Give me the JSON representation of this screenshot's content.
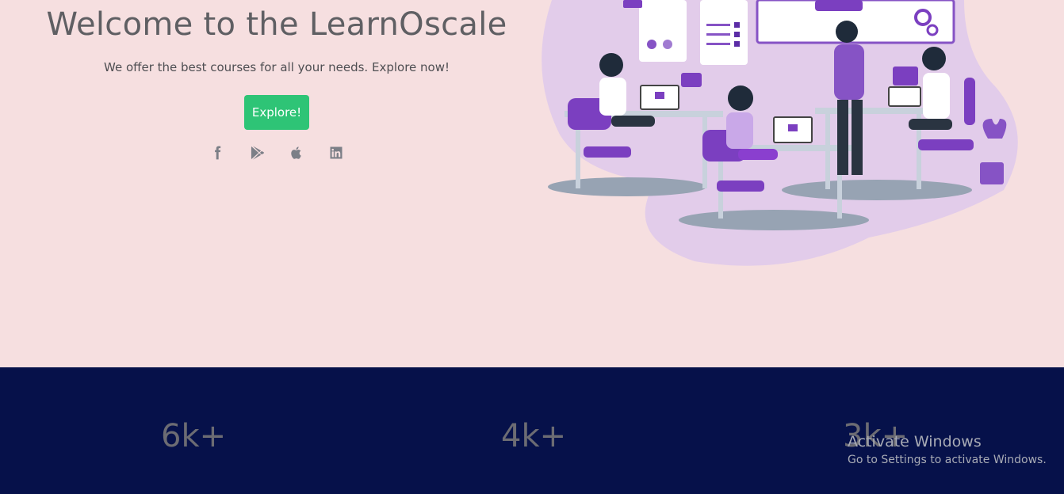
{
  "hero": {
    "title": "Welcome to the LearnOscale",
    "subtitle": "We offer the best courses for all your needs. Explore now!",
    "cta_label": "Explore!",
    "socials": [
      "facebook-icon",
      "google-play-icon",
      "apple-icon",
      "linkedin-icon"
    ]
  },
  "stats": {
    "items": [
      "6k+",
      "4k+",
      "3k+"
    ]
  },
  "activation": {
    "title": "Activate Windows",
    "subtitle": "Go to Settings to activate Windows."
  },
  "colors": {
    "hero_bg": "#f6dfe0",
    "cta_bg": "#2ec476",
    "stats_bg": "#06114a",
    "accent_purple": "#7b3fc0"
  }
}
